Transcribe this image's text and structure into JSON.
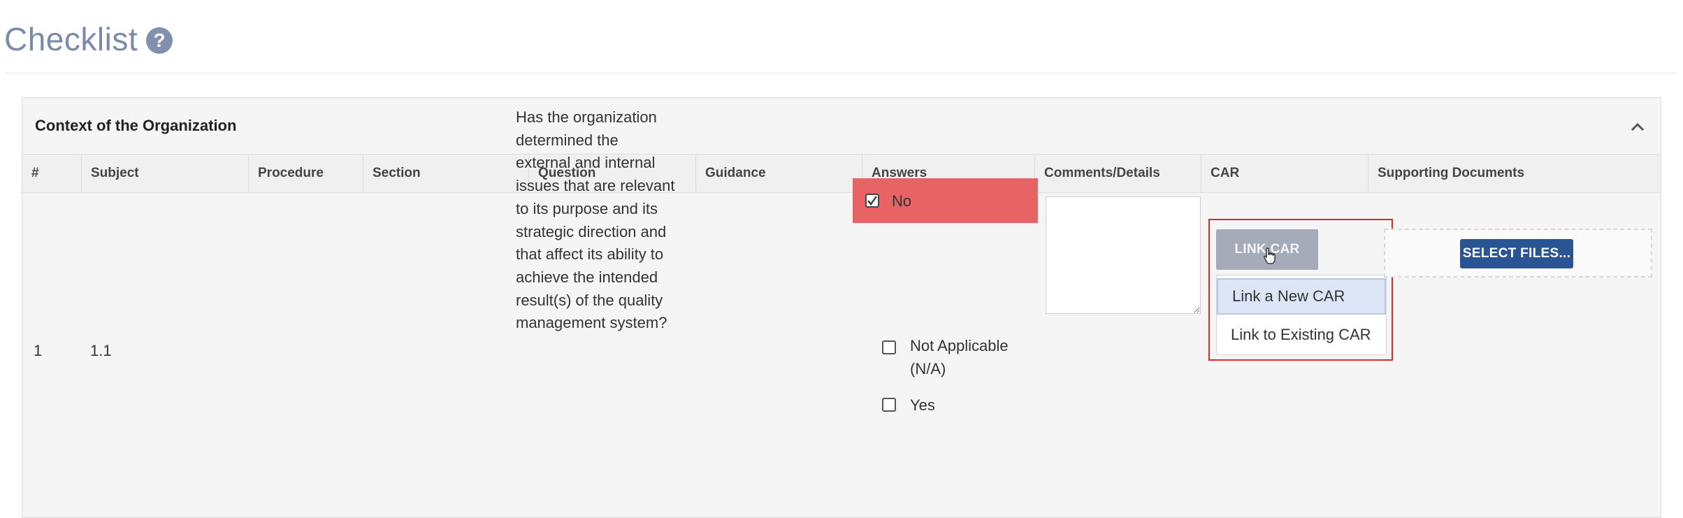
{
  "page": {
    "title": "Checklist",
    "help_icon": "question-circle-icon",
    "help_glyph": "?"
  },
  "section": {
    "title": "Context of the Organization",
    "collapse_icon": "chevron-up-icon"
  },
  "columns": [
    "#",
    "Subject",
    "Procedure",
    "Section",
    "Question",
    "Guidance",
    "Answers",
    "Comments/Details",
    "CAR",
    "Supporting Documents"
  ],
  "row": {
    "number": "1",
    "subject": "1.1",
    "procedure": "",
    "section": "",
    "question": "Has the organization determined the external and internal issues that are relevant to its purpose and its strategic direction and that affect its ability to achieve the intended result(s) of the quality management system?",
    "guidance": "",
    "answers": [
      {
        "label": "No",
        "checked": true
      },
      {
        "label": "Not Applicable (N/A)",
        "checked": false
      },
      {
        "label": "Yes",
        "checked": false
      }
    ],
    "comments": ""
  },
  "car": {
    "button_label": "LINK CAR",
    "menu": [
      "Link a New CAR",
      "Link to Existing CAR"
    ]
  },
  "documents": {
    "button_label": "SELECT FILES..."
  },
  "colors": {
    "accent": "#2b5495",
    "selected_answer": "#e86363",
    "highlight_outline": "#e02828",
    "title": "#7a8aa8"
  }
}
